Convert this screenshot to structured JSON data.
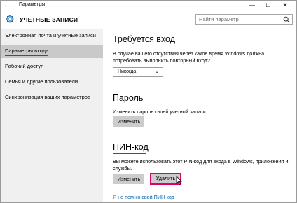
{
  "window": {
    "title": "Параметры",
    "controls": {
      "minimize": "—",
      "maximize": "☐",
      "close": "✕"
    },
    "back_glyph": "←"
  },
  "header": {
    "icon": "gear-icon",
    "title": "УЧЕТНЫЕ ЗАПИСИ",
    "search_placeholder": "Найти параметр",
    "search_icon": "search-icon"
  },
  "sidebar": {
    "items": [
      {
        "label": "Электронная почта и учетные записи",
        "active": false
      },
      {
        "label": "Параметры входа",
        "active": true
      },
      {
        "label": "Рабочий доступ",
        "active": false
      },
      {
        "label": "Семья и другие пользователи",
        "active": false
      },
      {
        "label": "Синхронизация ваших параметров",
        "active": false
      }
    ]
  },
  "main": {
    "require_signin": {
      "heading": "Требуется вход",
      "description": "В случае вашего отсутствия через какое время Windows должна потребовать выполнить повторный вход?",
      "dropdown_value": "Никогда"
    },
    "password": {
      "heading": "Пароль",
      "description": "Изменить пароль своей учетной записи",
      "change_label": "Изменить"
    },
    "pin": {
      "heading": "ПИН-код",
      "description": "Вы можете использовать этот PIN-код для входа в Windows, приложения и службы.",
      "change_label": "Изменить",
      "delete_label": "Удалить",
      "forgot_link": "Я не помню свой ПИН-код"
    }
  },
  "colors": {
    "accent_highlight": "#e0006b",
    "link": "#0063b1",
    "sidebar_bg": "#f0f0f0",
    "selected_bg": "#c9c9c9",
    "button_bg": "#cccccc"
  }
}
